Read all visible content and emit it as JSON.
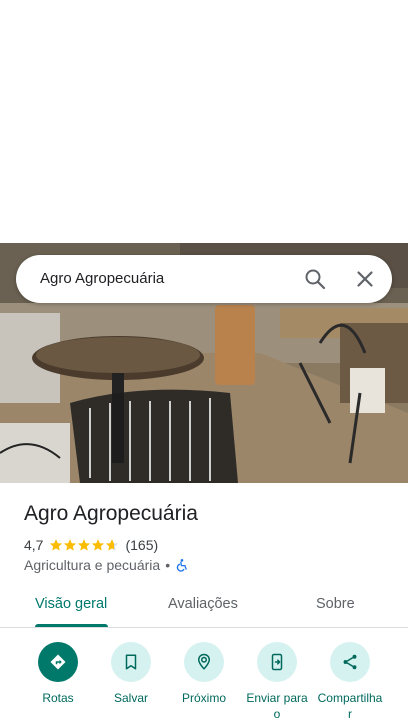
{
  "search": {
    "query": "Agro Agropecuária"
  },
  "place": {
    "name": "Agro Agropecuária",
    "rating": "4,7",
    "rating_value": 4.7,
    "review_count": "(165)",
    "category": "Agricultura e pecuária",
    "separator": "•"
  },
  "tabs": [
    {
      "label": "Visão geral",
      "active": true
    },
    {
      "label": "Avaliações",
      "active": false
    },
    {
      "label": "Sobre",
      "active": false
    }
  ],
  "actions": [
    {
      "label": "Rotas",
      "icon": "directions-icon"
    },
    {
      "label": "Salvar",
      "icon": "bookmark-icon"
    },
    {
      "label": "Próximo",
      "icon": "nearby-icon"
    },
    {
      "label": "Enviar para\no",
      "icon": "send-to-phone-icon"
    },
    {
      "label": "Compartilha\nr",
      "icon": "share-icon"
    }
  ],
  "colors": {
    "accent": "#00796b",
    "action_bg": "#d6f2f0",
    "star": "#fbbc04"
  }
}
